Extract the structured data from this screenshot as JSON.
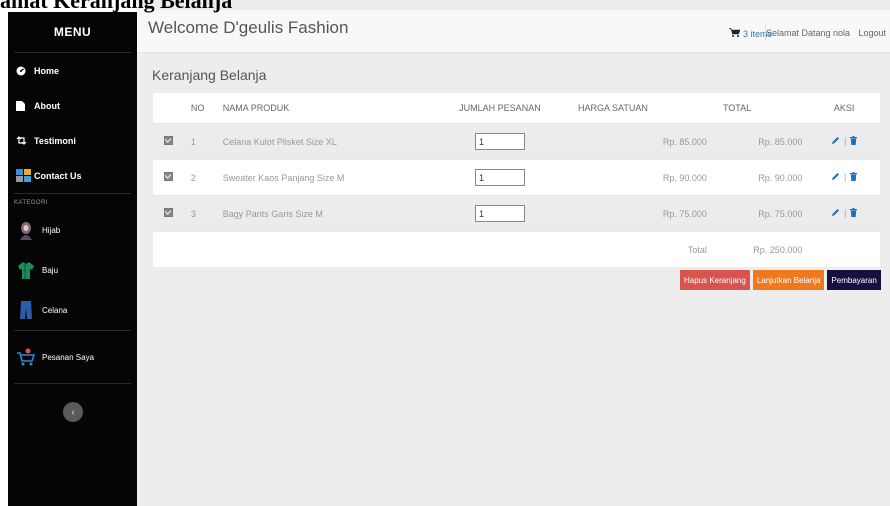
{
  "document_caption": "amat Keranjang Belanja",
  "sidebar": {
    "menu_title": "MENU",
    "items": [
      {
        "label": "Home",
        "icon": "dashboard-icon"
      },
      {
        "label": "About",
        "icon": "file-icon"
      },
      {
        "label": "Testimoni",
        "icon": "retweet-icon"
      },
      {
        "label": "Contact Us",
        "icon": "contact-icon"
      }
    ],
    "category_heading": "KATEGORI",
    "categories": [
      {
        "label": "Hijab",
        "icon": "hijab-icon"
      },
      {
        "label": "Baju",
        "icon": "shirt-icon"
      },
      {
        "label": "Celana",
        "icon": "pants-icon"
      }
    ],
    "orders_label": "Pesanan Saya",
    "orders_icon": "shopping-cart-icon",
    "collapse_glyph": "‹"
  },
  "header": {
    "title": "Welcome D'geulis Fashion",
    "cart_count": "3 items",
    "greeting": "Selamat Datang nola",
    "logout": "Logout"
  },
  "page": {
    "heading": "Keranjang Belanja"
  },
  "table": {
    "headers": {
      "no": "NO",
      "name": "NAMA PRODUK",
      "qty": "JUMLAH PESANAN",
      "price": "HARGA SATUAN",
      "total": "TOTAL",
      "aksi": "AKSI"
    },
    "rows": [
      {
        "no": "1",
        "name": "Celana Kulot Plisket Size XL",
        "qty": "1",
        "price": "Rp. 85.000",
        "total": "Rp. 85.000"
      },
      {
        "no": "2",
        "name": "Sweater Kaos Panjang Size M",
        "qty": "1",
        "price": "Rp. 90.000",
        "total": "Rp. 90.000"
      },
      {
        "no": "3",
        "name": "Bagy Pants Garis Size M",
        "qty": "1",
        "price": "Rp. 75.000",
        "total": "Rp. 75.000"
      }
    ],
    "footer_label": "Total",
    "grand_total": "Rp. 250.000",
    "aksi_separator": "|"
  },
  "buttons": {
    "clear": "Hapus Keranjang",
    "continue": "Lanjutkan Belanja",
    "checkout": "Pembayaran"
  },
  "colors": {
    "link_blue": "#337ab7",
    "btn_red": "#d9534f",
    "btn_orange": "#f0791f",
    "btn_navy": "#191042",
    "sidebar_bg": "#050505"
  }
}
